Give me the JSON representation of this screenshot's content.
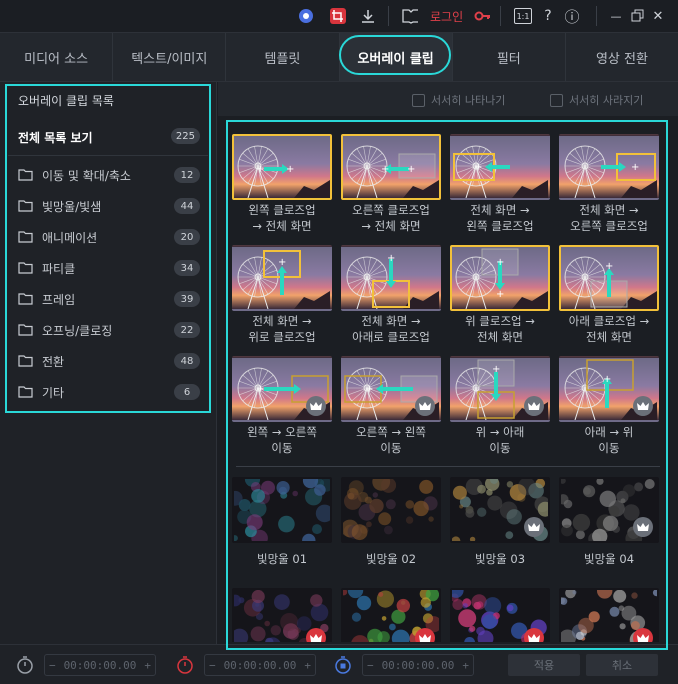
{
  "titlebar": {
    "login_label": "로그인",
    "icons": [
      "circle-app-icon",
      "crop-icon",
      "download-icon",
      "book-icon",
      "key-icon",
      "aspect-ratio-icon",
      "help-icon",
      "info-icon",
      "minimize-icon",
      "restore-icon",
      "close-icon"
    ],
    "help_glyph": "?",
    "info_glyph": "ⓘ",
    "ratio_glyph": "1:1",
    "close_glyph": "✕",
    "minimize_glyph": "—"
  },
  "tabs": [
    {
      "label": "미디어 소스"
    },
    {
      "label": "텍스트/이미지"
    },
    {
      "label": "템플릿"
    },
    {
      "label": "오버레이 클립"
    },
    {
      "label": "필터"
    },
    {
      "label": "영상 전환"
    }
  ],
  "active_tab": "오버레이 클립",
  "sidebar": {
    "header": "오버레이 클립 목록",
    "all": {
      "label": "전체 목록 보기",
      "count": "225"
    },
    "items": [
      {
        "label": "이동 및 확대/축소",
        "count": "12"
      },
      {
        "label": "빛망울/빛샘",
        "count": "44"
      },
      {
        "label": "애니메이션",
        "count": "20"
      },
      {
        "label": "파티클",
        "count": "34"
      },
      {
        "label": "프레임",
        "count": "39"
      },
      {
        "label": "오프닝/클로징",
        "count": "22"
      },
      {
        "label": "전환",
        "count": "48"
      },
      {
        "label": "기타",
        "count": "6"
      }
    ]
  },
  "options": {
    "fade_in": "서서히 나타나기",
    "fade_out": "서서히 사라지기"
  },
  "clips": [
    {
      "cap1": "왼쪽 클로즈업",
      "cap2": "→ 전체 화면",
      "selected": true,
      "premium": false
    },
    {
      "cap1": "오른쪽 클로즈업",
      "cap2": "→ 전체 화면",
      "selected": true,
      "premium": false
    },
    {
      "cap1": "전체 화면 →",
      "cap2": "왼쪽 클로즈업",
      "selected": false,
      "premium": false
    },
    {
      "cap1": "전체 화면 →",
      "cap2": "오른쪽 클로즈업",
      "selected": false,
      "premium": false
    },
    {
      "cap1": "전체 화면 →",
      "cap2": "위로 클로즈업",
      "selected": false,
      "premium": false
    },
    {
      "cap1": "전체 화면 →",
      "cap2": "아래로 클로즈업",
      "selected": false,
      "premium": false
    },
    {
      "cap1": "위 클로즈업 →",
      "cap2": "전체 화면",
      "selected": true,
      "premium": false
    },
    {
      "cap1": "아래 클로즈업 →",
      "cap2": "전체 화면",
      "selected": true,
      "premium": false
    },
    {
      "cap1": "왼쪽 → 오른쪽",
      "cap2": "이동",
      "selected": false,
      "premium": true
    },
    {
      "cap1": "오른쪽 → 왼쪽",
      "cap2": "이동",
      "selected": false,
      "premium": true
    },
    {
      "cap1": "위 → 아래",
      "cap2": "이동",
      "selected": false,
      "premium": true
    },
    {
      "cap1": "아래 → 위",
      "cap2": "이동",
      "selected": false,
      "premium": true
    },
    {
      "cap1": "빛망울 01",
      "cap2": "",
      "selected": false,
      "premium": false
    },
    {
      "cap1": "빛망울 02",
      "cap2": "",
      "selected": false,
      "premium": false
    },
    {
      "cap1": "빛망울 03",
      "cap2": "",
      "selected": false,
      "premium": true
    },
    {
      "cap1": "빛망울 04",
      "cap2": "",
      "selected": false,
      "premium": true
    },
    {
      "cap1": "",
      "cap2": "",
      "selected": false,
      "premium": true
    },
    {
      "cap1": "",
      "cap2": "",
      "selected": false,
      "premium": true
    },
    {
      "cap1": "",
      "cap2": "",
      "selected": false,
      "premium": true
    },
    {
      "cap1": "",
      "cap2": "",
      "selected": false,
      "premium": true
    }
  ],
  "bottombar": {
    "timecode1": "00:00:00.00",
    "timecode2": "00:00:00.00",
    "timecode3": "00:00:00.00",
    "minus": "−",
    "plus": "+",
    "apply_label": "적용",
    "cancel_label": "취소"
  },
  "colors": {
    "accent_cyan": "#2ad8d8",
    "selection_gold": "#f2c13a",
    "login_red": "#e0404a",
    "premium_red": "#d9363e"
  }
}
